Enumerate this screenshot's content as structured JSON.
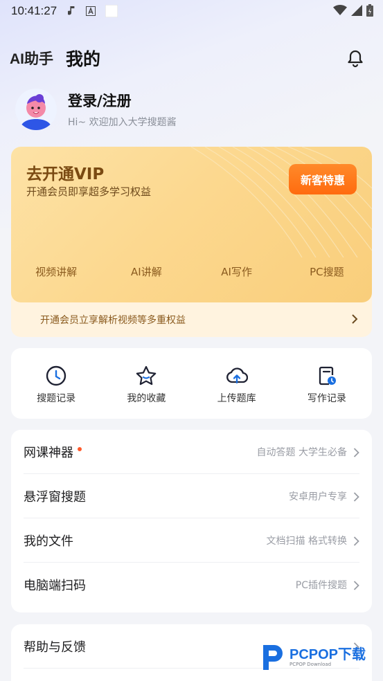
{
  "status_bar": {
    "time": "10:41:27"
  },
  "header": {
    "app_name": "AI助手",
    "title": "我的"
  },
  "profile": {
    "name": "登录/注册",
    "subtitle": "Hi~ 欢迎加入大学搜题酱"
  },
  "vip": {
    "title": "去开通VIP",
    "subtitle": "开通会员即享超多学习权益",
    "button": "新客特惠",
    "benefits": [
      "视频讲解",
      "AI讲解",
      "AI写作",
      "PC搜题"
    ],
    "footer": "开通会员立享解析视频等多重权益"
  },
  "quick": [
    {
      "label": "搜题记录",
      "icon": "clock-icon"
    },
    {
      "label": "我的收藏",
      "icon": "star-icon"
    },
    {
      "label": "上传题库",
      "icon": "cloud-upload-icon"
    },
    {
      "label": "写作记录",
      "icon": "document-clock-icon"
    }
  ],
  "menu": [
    {
      "label": "网课神器",
      "note": "自动答题 大学生必备",
      "badge": true
    },
    {
      "label": "悬浮窗搜题",
      "note": "安卓用户专享"
    },
    {
      "label": "我的文件",
      "note": "文档扫描 格式转换"
    },
    {
      "label": "电脑端扫码",
      "note": "PC插件搜题"
    }
  ],
  "menu2": [
    {
      "label": "帮助与反馈"
    }
  ],
  "watermark": {
    "brand": "PCPOP下载",
    "small": "PCPOP Download"
  },
  "colors": {
    "accent_orange": "#ff6b0f",
    "vip_gold": "#fcd88f",
    "badge_red": "#ff5a2b",
    "icon_blue": "#1a6fe0"
  }
}
